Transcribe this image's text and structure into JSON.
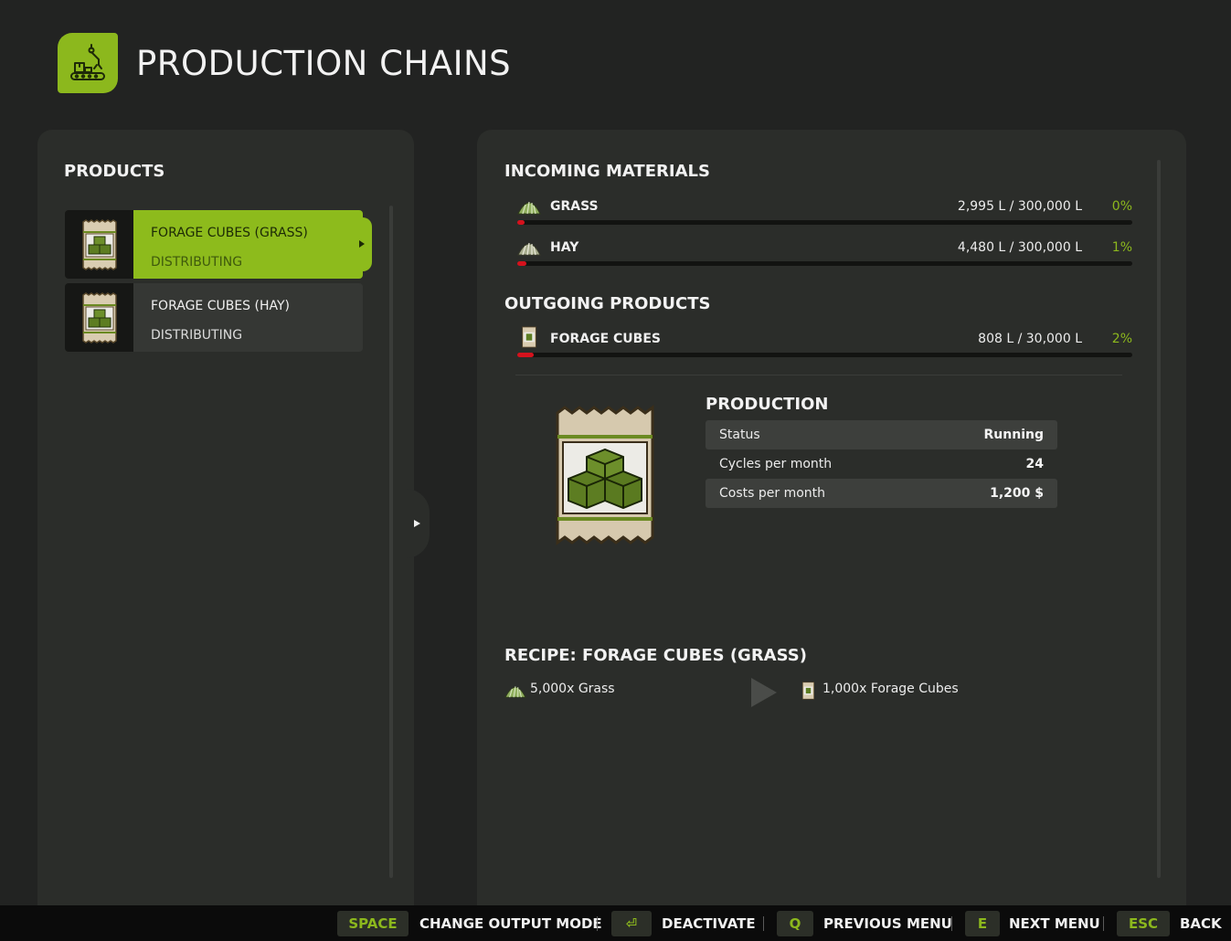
{
  "header": {
    "title": "PRODUCTION CHAINS",
    "icon": "conveyor-robot-arm-icon"
  },
  "products_panel": {
    "title": "PRODUCTS",
    "items": [
      {
        "name": "FORAGE CUBES (GRASS)",
        "status": "DISTRIBUTING",
        "selected": true,
        "icon": "forage-cube-bag-icon"
      },
      {
        "name": "FORAGE CUBES (HAY)",
        "status": "DISTRIBUTING",
        "selected": false,
        "icon": "forage-cube-bag-icon"
      }
    ]
  },
  "incoming": {
    "title": "INCOMING MATERIALS",
    "items": [
      {
        "name": "GRASS",
        "amount": "2,995 L / 300,000 L",
        "percent": "0%",
        "fill": 0.01,
        "icon": "grass-icon"
      },
      {
        "name": "HAY",
        "amount": "4,480 L / 300,000 L",
        "percent": "1%",
        "fill": 0.015,
        "icon": "hay-icon"
      }
    ]
  },
  "outgoing": {
    "title": "OUTGOING PRODUCTS",
    "items": [
      {
        "name": "FORAGE CUBES",
        "amount": "808 L / 30,000 L",
        "percent": "2%",
        "fill": 0.027,
        "icon": "forage-cube-bag-icon"
      }
    ]
  },
  "production": {
    "title": "PRODUCTION",
    "rows": [
      {
        "label": "Status",
        "value": "Running"
      },
      {
        "label": "Cycles per month",
        "value": "24"
      },
      {
        "label": "Costs per month",
        "value": "1,200 $"
      }
    ]
  },
  "recipe": {
    "title": "RECIPE: FORAGE CUBES (GRASS)",
    "input": "5,000x Grass",
    "output": "1,000x Forage Cubes"
  },
  "footer": {
    "actions": [
      {
        "key": "SPACE",
        "label": "CHANGE OUTPUT MODE"
      },
      {
        "key": "⏎",
        "label": "DEACTIVATE"
      },
      {
        "key": "Q",
        "label": "PREVIOUS MENU"
      },
      {
        "key": "E",
        "label": "NEXT MENU"
      },
      {
        "key": "ESC",
        "label": "BACK"
      }
    ]
  },
  "colors": {
    "accent": "#8cb81d",
    "panel": "#2b2d2a",
    "background": "#222322",
    "fill_low": "#d4121d"
  }
}
